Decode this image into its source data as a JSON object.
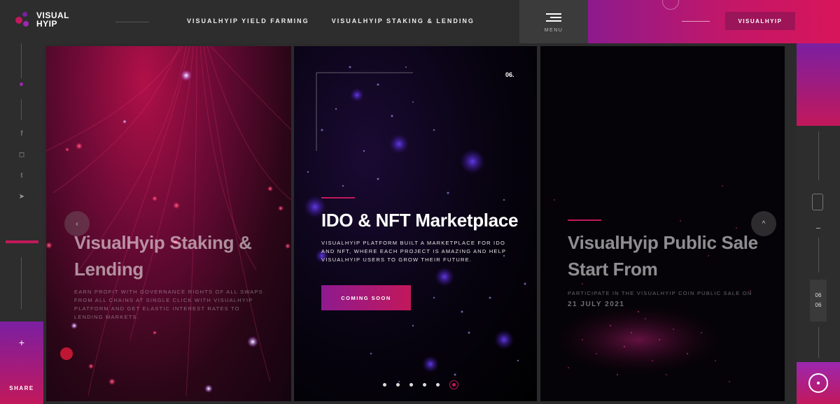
{
  "brand": {
    "line1": "VISUAL",
    "line2": "HYIP"
  },
  "nav": {
    "items": [
      {
        "label": "VISUALHYIP YIELD FARMING"
      },
      {
        "label": "VISUALHYIP STAKING & LENDING"
      }
    ],
    "menu_label": "MENU",
    "cta_label": "VISUALHYIP"
  },
  "sidebar": {
    "social": [
      {
        "icon": "facebook-icon",
        "glyph": "f"
      },
      {
        "icon": "instagram-icon",
        "glyph": "◻"
      },
      {
        "icon": "twitter-icon",
        "glyph": "t"
      },
      {
        "icon": "telegram-icon",
        "glyph": "➤"
      }
    ],
    "share_plus": "+",
    "share_label": "SHARE"
  },
  "slides": [
    {
      "title_line1": "VisualHyip Staking &",
      "title_line2": "Lending",
      "description": "EARN PROFIT WITH GOVERNANCE RIGHTS OF ALL SWAPS FROM ALL CHAINS AT SINGLE CLICK WITH VISUALHYIP PLATFORM AND GET ELASTIC INTEREST RATES TO LENDING MARKETS."
    },
    {
      "number": "06.",
      "title": "IDO & NFT Marketplace",
      "description": "VISUALHYIP PLATFORM BUILT A MARKETPLACE FOR IDO AND NFT, WHERE EACH PROJECT IS AMAZING AND HELP VISUALHYIP USERS TO GROW THEIR FUTURE.",
      "button_label": "COMING SOON"
    },
    {
      "title_line1": "VisualHyip Public Sale",
      "title_line2": "Start From",
      "description": "PARTICIPATE IN THE VISUALHYIP COIN PUBLIC SALE ON",
      "date": "21 JULY 2021"
    }
  ],
  "counter": {
    "current": "06",
    "total": "06"
  },
  "colors": {
    "accent": "#c2185b",
    "accent_purple": "#8e1a8f"
  }
}
